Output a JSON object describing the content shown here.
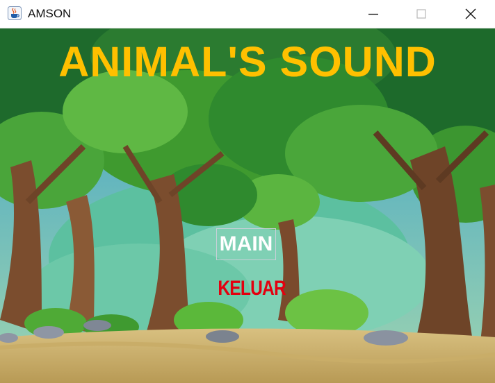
{
  "window": {
    "title": "AMSON",
    "icon": "java-cup-icon",
    "controls": [
      "minimize-icon",
      "maximize-icon",
      "close-icon"
    ]
  },
  "game": {
    "title": "ANIMAL'S SOUND",
    "title_color": "#ffc000",
    "menu": {
      "main_label": "MAIN",
      "exit_label": "KELUAR",
      "main_color": "#ffffff",
      "exit_color": "#e3000f"
    },
    "background": "forest-background"
  }
}
